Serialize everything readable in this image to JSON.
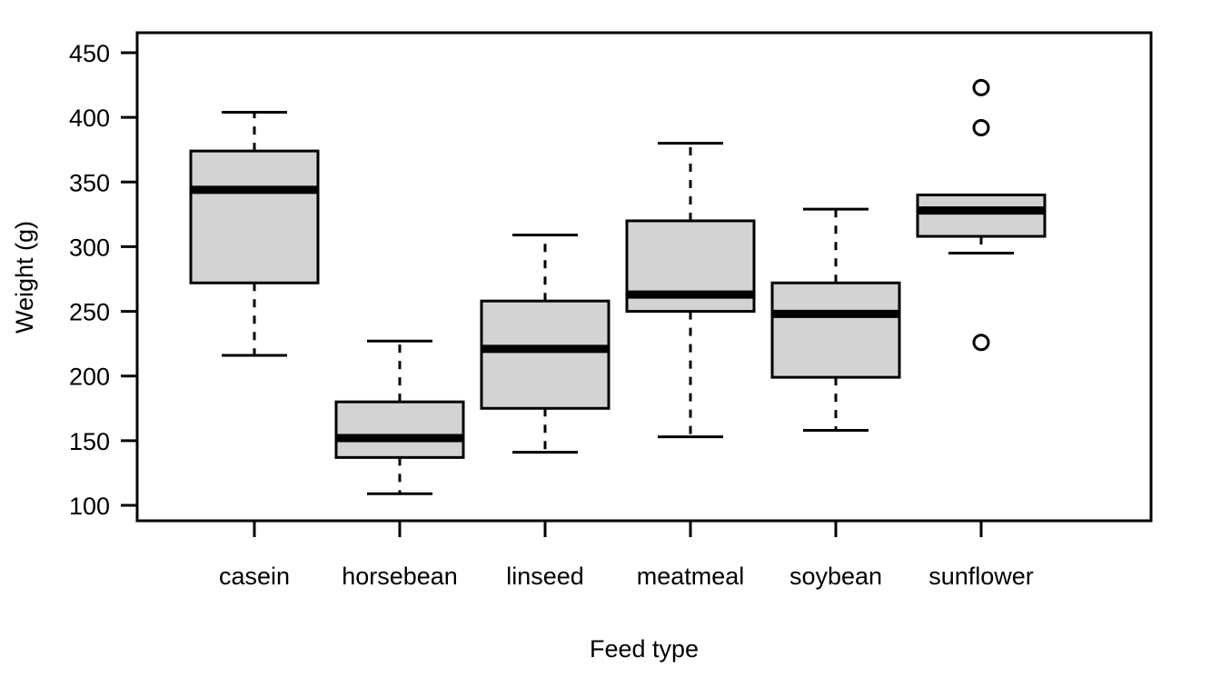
{
  "chart_data": {
    "type": "box",
    "title": "",
    "xlabel": "Feed type",
    "ylabel": "Weight (g)",
    "categories": [
      "casein",
      "horsebean",
      "linseed",
      "meatmeal",
      "soybean",
      "sunflower"
    ],
    "ylim": [
      88,
      460
    ],
    "y_ticks": [
      100,
      150,
      200,
      250,
      300,
      350,
      400,
      450
    ],
    "y_tick_labels": [
      "100",
      "150",
      "200",
      "250",
      "300",
      "350",
      "400",
      "450"
    ],
    "grid": false,
    "legend": null,
    "box_fill_color": "#d3d3d3",
    "box_line_color": "#000000",
    "boxes": [
      {
        "category": "casein",
        "lower_whisker": 216,
        "q1": 272,
        "median": 344,
        "q3": 374,
        "upper_whisker": 404,
        "outliers": []
      },
      {
        "category": "horsebean",
        "lower_whisker": 109,
        "q1": 137,
        "median": 152,
        "q3": 180,
        "upper_whisker": 227,
        "outliers": []
      },
      {
        "category": "linseed",
        "lower_whisker": 141,
        "q1": 175,
        "median": 221,
        "q3": 258,
        "upper_whisker": 309,
        "outliers": []
      },
      {
        "category": "meatmeal",
        "lower_whisker": 153,
        "q1": 250,
        "median": 263,
        "q3": 320,
        "upper_whisker": 380,
        "outliers": []
      },
      {
        "category": "soybean",
        "lower_whisker": 158,
        "q1": 199,
        "median": 248,
        "q3": 272,
        "upper_whisker": 329,
        "outliers": []
      },
      {
        "category": "sunflower",
        "lower_whisker": 295,
        "q1": 308,
        "median": 328,
        "q3": 340,
        "upper_whisker": 340,
        "outliers": [
          423,
          392,
          226
        ]
      }
    ]
  },
  "axes": {
    "y_title": "Weight (g)",
    "x_title": "Feed type"
  }
}
